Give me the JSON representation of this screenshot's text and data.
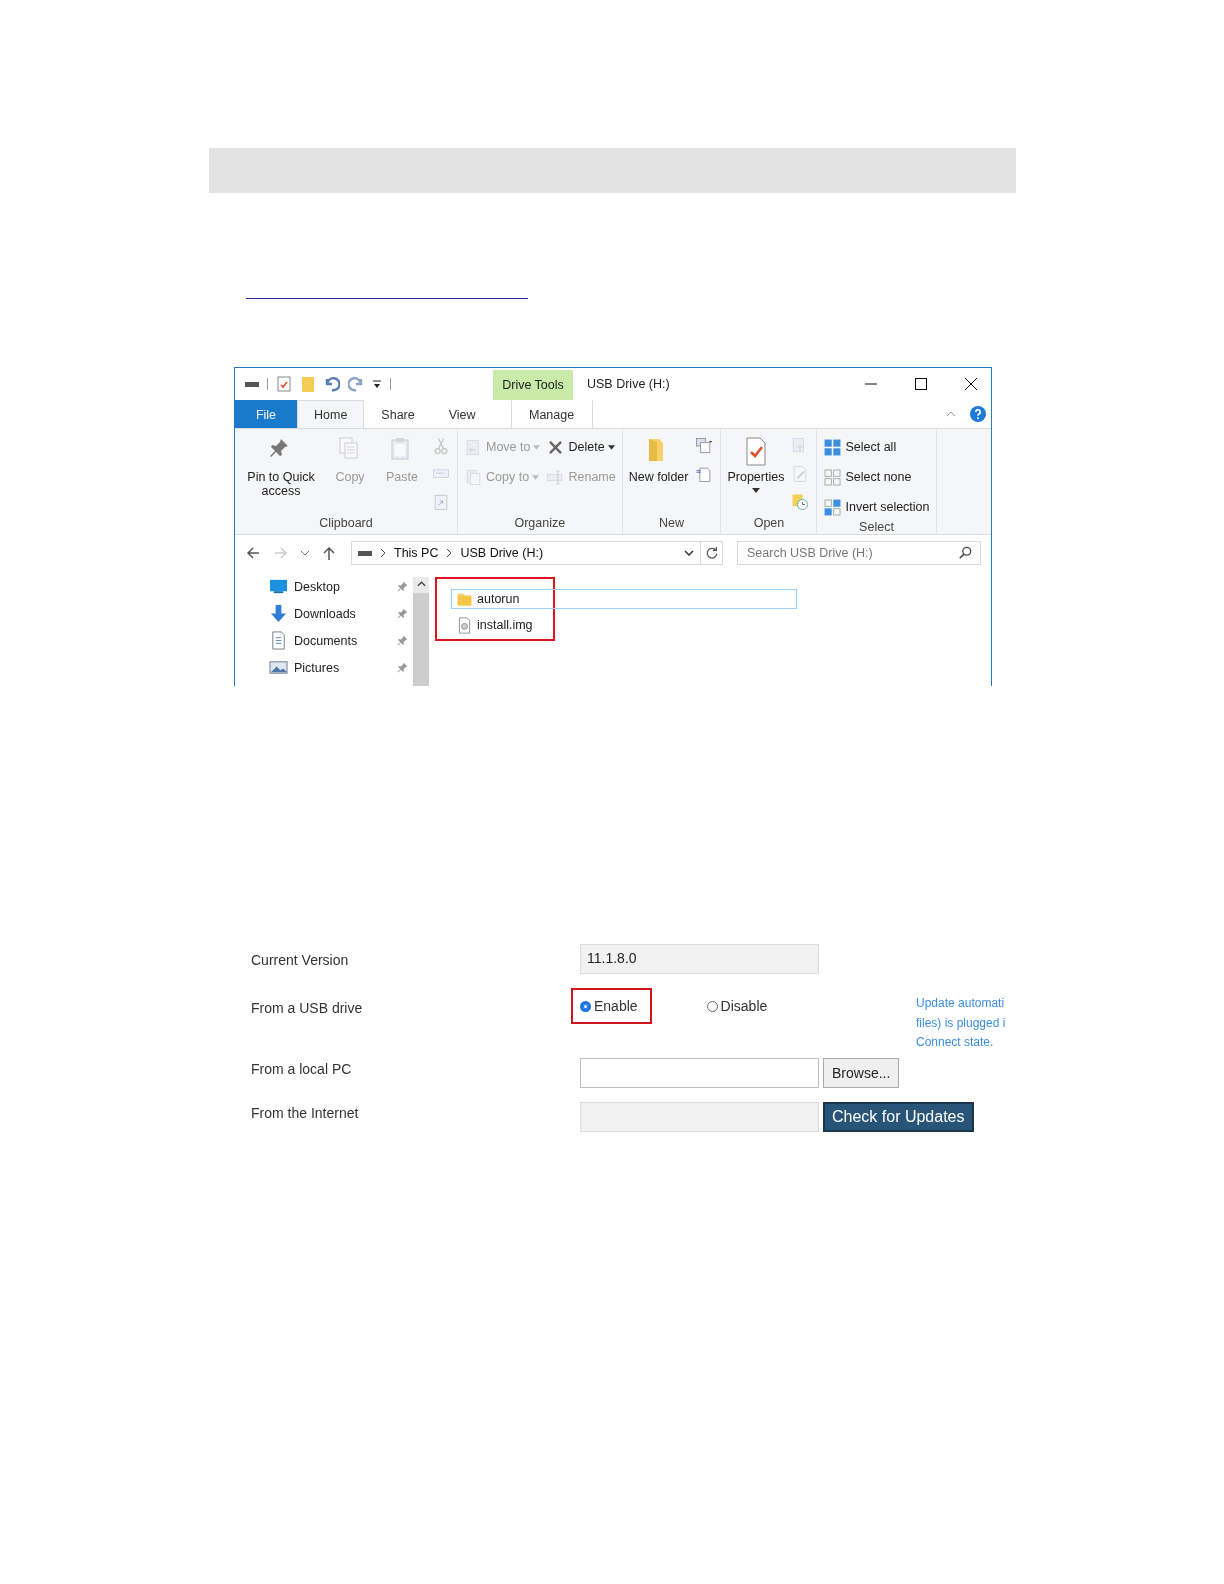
{
  "explorer": {
    "window_title": "USB Drive (H:)",
    "context_label": "Drive Tools",
    "tabs": [
      {
        "label": "File",
        "kind": "file",
        "selected": false
      },
      {
        "label": "Home",
        "kind": "tab",
        "selected": true
      },
      {
        "label": "Share",
        "kind": "tab",
        "selected": false
      },
      {
        "label": "View",
        "kind": "tab",
        "selected": false
      },
      {
        "label": "Manage",
        "kind": "context",
        "selected": false
      }
    ],
    "ribbon_groups": [
      {
        "title": "Clipboard",
        "columns": [
          [
            {
              "kind": "large",
              "label": "Pin to Quick access",
              "disabled": false
            }
          ],
          [
            {
              "kind": "large",
              "label": "Copy",
              "disabled": true
            }
          ],
          [
            {
              "kind": "large",
              "label": "Paste",
              "disabled": true
            }
          ],
          [
            {
              "kind": "icon",
              "disabled": true
            },
            {
              "kind": "icon",
              "disabled": true
            },
            {
              "kind": "icon",
              "disabled": true
            }
          ]
        ]
      },
      {
        "title": "Organize",
        "columns": [
          [
            {
              "kind": "small",
              "label": "Move to",
              "disabled": true,
              "dropdown": true
            },
            {
              "kind": "small",
              "label": "Copy to",
              "disabled": true,
              "dropdown": true
            }
          ],
          [
            {
              "kind": "small",
              "label": "Delete",
              "disabled": false,
              "dropdown": true
            },
            {
              "kind": "small",
              "label": "Rename",
              "disabled": true,
              "dropdown": false
            }
          ]
        ]
      },
      {
        "title": "New",
        "columns": [
          [
            {
              "kind": "large",
              "label": "New folder",
              "disabled": false
            }
          ],
          [
            {
              "kind": "icon",
              "disabled": false
            },
            {
              "kind": "icon",
              "disabled": false
            }
          ]
        ]
      },
      {
        "title": "Open",
        "columns": [
          [
            {
              "kind": "large",
              "label": "Properties",
              "disabled": false,
              "dropdown": true
            }
          ],
          [
            {
              "kind": "icon",
              "disabled": true
            },
            {
              "kind": "icon",
              "disabled": true
            },
            {
              "kind": "icon",
              "disabled": false
            }
          ]
        ]
      },
      {
        "title": "Select",
        "columns": [
          [
            {
              "kind": "small",
              "label": "Select all",
              "disabled": false
            },
            {
              "kind": "small",
              "label": "Select none",
              "disabled": false
            },
            {
              "kind": "small",
              "label": "Invert selection",
              "disabled": false
            }
          ]
        ]
      }
    ],
    "breadcrumb": [
      "This PC",
      "USB Drive (H:)"
    ],
    "search": {
      "placeholder": "Search USB Drive (H:)"
    },
    "nav_items": [
      {
        "label": "Desktop",
        "kind": "desktop",
        "pinned": true
      },
      {
        "label": "Downloads",
        "kind": "downloads",
        "pinned": true
      },
      {
        "label": "Documents",
        "kind": "documents",
        "pinned": true
      },
      {
        "label": "Pictures",
        "kind": "pictures",
        "pinned": true
      }
    ],
    "files_highlighted": true,
    "files": [
      {
        "name": "autorun",
        "kind": "folder",
        "selected": true
      },
      {
        "name": "install.img",
        "kind": "image",
        "selected": false
      }
    ]
  },
  "firmware_form": {
    "rows": [
      {
        "label": "Current Version",
        "kind": "readonly",
        "value": "11.1.8.0"
      },
      {
        "label": "From a USB drive",
        "kind": "radio",
        "highlighted": true,
        "options": [
          {
            "label": "Enable",
            "selected": true
          },
          {
            "label": "Disable",
            "selected": false
          }
        ],
        "note_lines": [
          "Update automati",
          "files) is plugged i",
          "Connect state."
        ]
      },
      {
        "label": "From a local PC",
        "kind": "file",
        "button": "Browse..."
      },
      {
        "label": "From the Internet",
        "kind": "online",
        "button": "Check for Updates"
      }
    ]
  }
}
